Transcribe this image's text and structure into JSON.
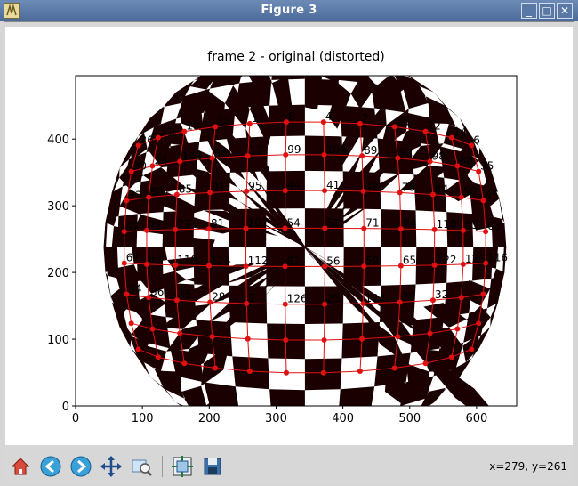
{
  "window": {
    "title": "Figure 3",
    "minimize": "_",
    "maximize": "□",
    "close": "✕"
  },
  "figure": {
    "title": "frame 2 - original (distorted)",
    "x_ticks": [
      "0",
      "100",
      "200",
      "300",
      "400",
      "500",
      "600"
    ],
    "y_ticks": [
      "400",
      "300",
      "200",
      "100",
      "0"
    ]
  },
  "point_labels": [
    "26",
    "21",
    "18",
    "16",
    "11",
    "8",
    "4",
    "2",
    "28",
    "22",
    "14",
    "6",
    "30",
    "24",
    "102",
    "96",
    "12",
    "99",
    "104",
    "89",
    "92",
    "98",
    "88",
    "35",
    "33",
    "82",
    "85",
    "91",
    "95",
    "44",
    "41",
    "39",
    "78",
    "84",
    "50",
    "45",
    "47",
    "72",
    "77",
    "81",
    "107",
    "54",
    "52",
    "71",
    "74",
    "110",
    "55",
    "63",
    "67",
    "69",
    "118",
    "114",
    "112",
    "62",
    "56",
    "59",
    "65",
    "122",
    "120",
    "116",
    "34",
    "36",
    "35",
    "28",
    "7",
    "126",
    "25",
    "124",
    "30",
    "32"
  ],
  "toolbar": {
    "home": "home-icon",
    "back": "back-arrow-icon",
    "forward": "forward-arrow-icon",
    "pan": "pan-icon",
    "zoom": "zoom-rect-icon",
    "subplots": "subplots-icon",
    "save": "save-icon"
  },
  "status": {
    "coords": "x=279, y=261"
  }
}
